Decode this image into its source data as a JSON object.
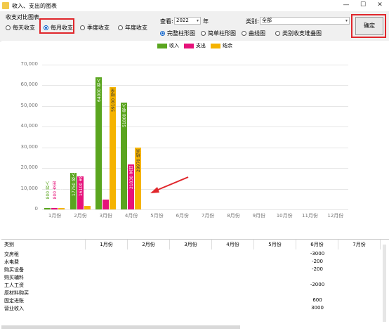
{
  "window": {
    "title": "收入、支出的图表",
    "buttons": [
      "—",
      "☐",
      "✕"
    ]
  },
  "toolbar": {
    "group_title": "收支对比图表",
    "period_options": [
      {
        "label": "每天收支",
        "selected": false
      },
      {
        "label": "每月收支",
        "selected": true
      },
      {
        "label": "季度收支",
        "selected": false
      },
      {
        "label": "年度收支",
        "selected": false
      }
    ],
    "view_label": "查看:",
    "year_value": "2022",
    "year_suffix": "年",
    "category_label": "类别:",
    "category_value": "全部",
    "chart_types": [
      {
        "label": "完整柱形图",
        "selected": true
      },
      {
        "label": "简单柱形图",
        "selected": false
      },
      {
        "label": "曲线图",
        "selected": false
      },
      {
        "label": "类别收支堆叠图",
        "selected": false
      }
    ],
    "ok_label": "确定"
  },
  "colors": {
    "income": "#5aa51f",
    "expense": "#e6127a",
    "balance": "#f5b300",
    "highlight": "#e0262b"
  },
  "chart_data": {
    "type": "bar",
    "categories": [
      "1月份",
      "2月份",
      "3月份",
      "4月份",
      "5月份",
      "6月份",
      "7月份",
      "8月份",
      "9月份",
      "10月份",
      "11月份",
      "12月份"
    ],
    "series": [
      {
        "name": "收入",
        "values": [
          800,
          17750,
          64000,
          51800,
          0,
          0,
          0,
          0,
          0,
          0,
          0,
          0
        ]
      },
      {
        "name": "支出",
        "values": [
          800,
          16100,
          4900,
          21830,
          0,
          0,
          0,
          0,
          0,
          0,
          0,
          0
        ]
      },
      {
        "name": "结余",
        "values": [
          600,
          1650,
          59100,
          29970,
          0,
          0,
          0,
          0,
          0,
          0,
          0,
          0
        ]
      }
    ],
    "data_labels": [
      [
        "800 收入",
        "800 支出",
        "600 结余"
      ],
      [
        "17750 收入",
        "16100 支出",
        "1650 结余"
      ],
      [
        "64000 收入",
        "4900 支出",
        "59100 结余"
      ],
      [
        "51800 收入",
        "21830 支出",
        "29970 结余"
      ]
    ],
    "ylim": [
      0,
      70000
    ],
    "yticks": [
      "0",
      "10,000",
      "20,000",
      "30,000",
      "40,000",
      "50,000",
      "60,000",
      "70,000"
    ],
    "grid": true,
    "legend_position": "top-center"
  },
  "table": {
    "headers": [
      "类别",
      "1月份",
      "2月份",
      "3月份",
      "4月份",
      "5月份",
      "6月份",
      "7月份"
    ],
    "rows": [
      {
        "label": "交房租",
        "m6": "-3000"
      },
      {
        "label": "水电费",
        "m6": "-200"
      },
      {
        "label": "购买设备",
        "m6": "-200"
      },
      {
        "label": "购买辅料",
        "m6": ""
      },
      {
        "label": "工人工资",
        "m6": "-2000"
      },
      {
        "label": "原材料购买",
        "m6": ""
      },
      {
        "label": "固定进账",
        "m6": "600"
      },
      {
        "label": "营业收入",
        "m6": "3000"
      }
    ]
  }
}
